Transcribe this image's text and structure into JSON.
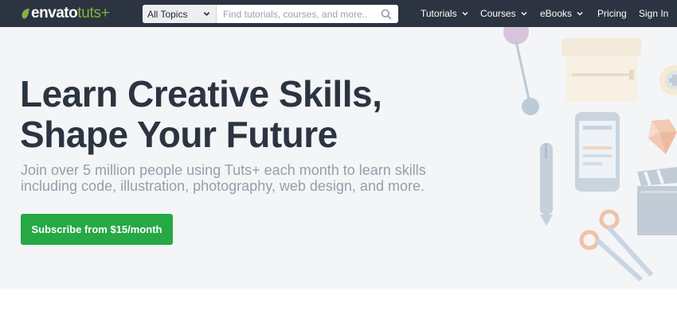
{
  "brand": {
    "envato": "envato",
    "tuts": "tuts+"
  },
  "search": {
    "topic_selected": "All Topics",
    "placeholder": "Find tutorials, courses, and more..."
  },
  "nav": {
    "tutorials": "Tutorials",
    "courses": "Courses",
    "ebooks": "eBooks",
    "pricing": "Pricing",
    "signin": "Sign In"
  },
  "hero": {
    "headline_line1": "Learn Creative Skills,",
    "headline_line2": "Shape Your Future",
    "subline_line1": "Join over 5 million people using Tuts+ each month to learn skills",
    "subline_line2": "including code, illustration, photography, web design, and more.",
    "cta": "Subscribe from $15/month"
  },
  "colors": {
    "topbar": "#2b3440",
    "accent_green": "#82b541",
    "cta_green": "#26a845",
    "hero_bg": "#f3f5f7",
    "headline": "#2b3440",
    "subline": "#93a0ad"
  },
  "icons": [
    "leaf-logo-icon",
    "chevron-down-icon",
    "search-icon",
    "pushpin-icon",
    "box-icon",
    "phone-icon",
    "pen-icon",
    "gem-icon",
    "clapperboard-icon",
    "scissors-icon",
    "plus-badge-icon"
  ]
}
